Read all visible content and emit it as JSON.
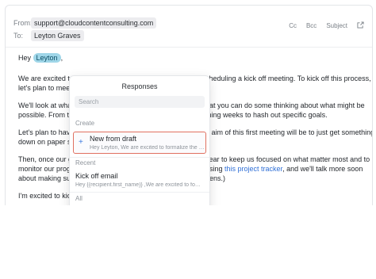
{
  "header": {
    "from_label": "From:",
    "from_value": "support@cloudcontentconsulting.com",
    "to_label": "To:",
    "to_value": "Leyton Graves",
    "cc": "Cc",
    "bcc": "Bcc",
    "subject": "Subject"
  },
  "email": {
    "greeting": "Hey",
    "mention": "Leyton",
    "greeting_end": ",",
    "p1_left_a": "We are excited t",
    "p1_right_a": "cheduling a kick off meeting. To kick off this process,",
    "p1_left_b": "let's plan to mee",
    "p2_left_a": "We'll look at wha",
    "p2_right_a": "hat you can do some thinking about what might be",
    "p2_left_b": "possible. From t",
    "p2_right_b": "ming weeks to hash out specific goals.",
    "p3_left_a": "Let's plan to hav",
    "p3_right_a": "e aim of this first meeting will be to just get something",
    "p3_left_b": "down on paper s",
    "p4_left_a": "Then, once our g",
    "p4_right_a": "year to keep us focused on what matter most and to",
    "p4_left_b": "monitor our prog",
    "p4_right_b_pre": "using",
    "p4_link": "this project tracker",
    "p4_right_b_post": ", and we'll talk more soon",
    "p4_left_c": "about making su",
    "p4_right_c": "pens.)",
    "p5_left": "I'm excited to kic"
  },
  "responses": {
    "title": "Responses",
    "search_placeholder": "Search",
    "create_label": "Create",
    "new_title": "New from draft",
    "new_sub": "Hey Leyton, We are excited to formalize the …",
    "recent_label": "Recent",
    "kickoff_title": "Kick off email",
    "kickoff_sub": "Hey {{recipient.first_name}} ,We are excited to for…",
    "all_label": "All"
  }
}
